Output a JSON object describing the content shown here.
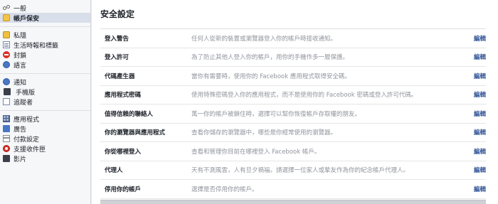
{
  "sidebar": {
    "groups": [
      [
        {
          "label": "一般",
          "icon": "gear-icon"
        },
        {
          "label": "帳戶保安",
          "icon": "shield-icon",
          "active": true
        }
      ],
      [
        {
          "label": "私隱",
          "icon": "lock-icon"
        },
        {
          "label": "生活時報和標籤",
          "icon": "timeline-icon"
        },
        {
          "label": "封鎖",
          "icon": "block-icon"
        },
        {
          "label": "語言",
          "icon": "globe-icon"
        }
      ],
      [
        {
          "label": "通知",
          "icon": "globe-bell-icon"
        },
        {
          "label": "手機版",
          "icon": "mobile-icon"
        },
        {
          "label": "追蹤者",
          "icon": "rss-icon"
        }
      ],
      [
        {
          "label": "應用程式",
          "icon": "apps-icon"
        },
        {
          "label": "廣告",
          "icon": "ads-icon"
        },
        {
          "label": "付款設定",
          "icon": "payment-icon"
        },
        {
          "label": "支援收件匣",
          "icon": "lifebuoy-icon"
        },
        {
          "label": "影片",
          "icon": "video-icon"
        }
      ]
    ]
  },
  "main": {
    "title": "安全設定",
    "edit_label": "編輯",
    "rows": [
      {
        "label": "登入警告",
        "desc": "任何人從新的裝置或瀏覽器登入你的帳戶時接收通知。"
      },
      {
        "label": "登入許可",
        "desc": "為了防止其他人登入你的帳戶，用你的手機作多一層保護。"
      },
      {
        "label": "代碼產生器",
        "desc": "當你有需要時，使用你的 Facebook 應用程式取得安全碼。"
      },
      {
        "label": "應用程式密碼",
        "desc": "使用特殊密碼登入你的應用程式，而不是使用你的 Facebook 密碼或登入許可代碼。"
      },
      {
        "label": "值得信賴的聯絡人",
        "desc": "萬一你的帳戶被鎖住時，選擇可以幫你恢復帳戶存取權的朋友。"
      },
      {
        "label": "你的瀏覽器與應用程式",
        "desc": "查看你儲存的瀏覽器中，哪些是你經常使用的瀏覽器。"
      },
      {
        "label": "你從哪裡登入",
        "desc": "查看和管理你目前在哪裡登入 Facebook 帳戶。"
      },
      {
        "label": "代理人",
        "desc": "天有不測風雲，人有旦夕禍福。請選擇一位家人或摯友作為你的紀念帳戶代理人。"
      },
      {
        "label": "停用你的帳戶",
        "desc": "選擇是否停用你的帳戶。"
      }
    ]
  }
}
